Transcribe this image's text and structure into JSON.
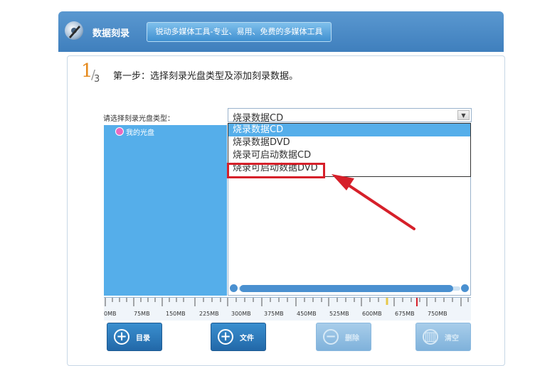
{
  "header": {
    "app_title": "数据刻录",
    "tagline": "锐动多媒体工具-专业、易用、免费的多媒体工具",
    "logo_icon": "disc-pen-icon"
  },
  "step": {
    "number": "1",
    "total": "3",
    "text": "第一步：选择刻录光盘类型及添加刻录数据。"
  },
  "disc_type": {
    "label": "请选择刻录光盘类型：",
    "selected": "烧录数据CD",
    "options": [
      "烧录数据CD",
      "烧录数据DVD",
      "烧录可启动数据CD",
      "烧录可启动数据DVD"
    ],
    "highlighted_index": 0,
    "annotated_index": 3
  },
  "tree": {
    "root_label": "我的光盘",
    "root_icon": "disc-icon"
  },
  "ruler": {
    "labels": [
      "0MB",
      "75MB",
      "150MB",
      "225MB",
      "300MB",
      "375MB",
      "450MB",
      "525MB",
      "600MB",
      "675MB",
      "750MB"
    ]
  },
  "buttons": {
    "folder_label": "目录",
    "file_label": "文件",
    "delete_label": "删除",
    "clear_label": "清空"
  },
  "colors": {
    "accent": "#4a90d0",
    "annotation": "#d6202a",
    "step_number": "#e58a1e"
  }
}
